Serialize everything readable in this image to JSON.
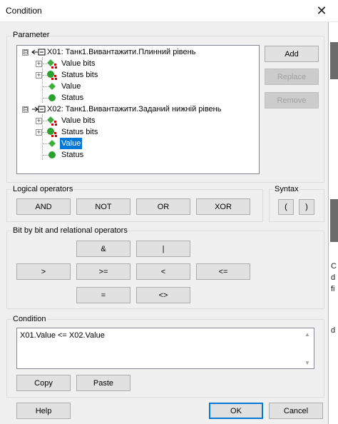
{
  "window": {
    "title": "Condition",
    "close_icon": "close-icon"
  },
  "background_app": {
    "fragments": [
      "C",
      "d",
      "fi",
      "d"
    ]
  },
  "parameter": {
    "group_label": "Parameter",
    "tree": [
      {
        "label": "X01: Танк1.Вивантажити.Плинний рівень",
        "level": 0,
        "icon": "variable-link-icon",
        "expander": "⊟"
      },
      {
        "label": "Value bits",
        "level": 1,
        "icon": "value-bits-icon",
        "expander": "+"
      },
      {
        "label": "Status bits",
        "level": 1,
        "icon": "status-bits-icon",
        "expander": "+"
      },
      {
        "label": "Value",
        "level": 1,
        "icon": "value-diamond-icon"
      },
      {
        "label": "Status",
        "level": 1,
        "icon": "status-circle-icon"
      },
      {
        "label": "X02: Танк1.Вивантажити.Заданий нижній рівень",
        "level": 0,
        "icon": "variable-link-icon",
        "expander": "⊟"
      },
      {
        "label": "Value bits",
        "level": 1,
        "icon": "value-bits-icon",
        "expander": "+"
      },
      {
        "label": "Status bits",
        "level": 1,
        "icon": "status-bits-icon",
        "expander": "+"
      },
      {
        "label": "Value",
        "level": 1,
        "icon": "value-diamond-icon",
        "selected": true
      },
      {
        "label": "Status",
        "level": 1,
        "icon": "status-circle-icon"
      }
    ],
    "buttons": {
      "add": "Add",
      "replace": "Replace",
      "remove": "Remove"
    }
  },
  "logical": {
    "group_label": "Logical operators",
    "buttons": {
      "and": "AND",
      "not": "NOT",
      "or": "OR",
      "xor": "XOR"
    }
  },
  "syntax": {
    "group_label": "Syntax",
    "buttons": {
      "open": "(",
      "close": ")"
    }
  },
  "bitwise": {
    "group_label": "Bit by bit and relational operators",
    "buttons": {
      "amp": "&",
      "pipe": "|",
      "gt": ">",
      "ge": ">=",
      "lt": "<",
      "le": "<=",
      "eq": "=",
      "ne": "<>"
    }
  },
  "condition": {
    "group_label": "Condition",
    "expression": "X01.Value <= X02.Value",
    "buttons": {
      "copy": "Copy",
      "paste": "Paste"
    }
  },
  "footer": {
    "help": "Help",
    "ok": "OK",
    "cancel": "Cancel"
  },
  "colors": {
    "accent": "#0078d7",
    "green": "#2ca02c",
    "red": "#cc0000"
  }
}
